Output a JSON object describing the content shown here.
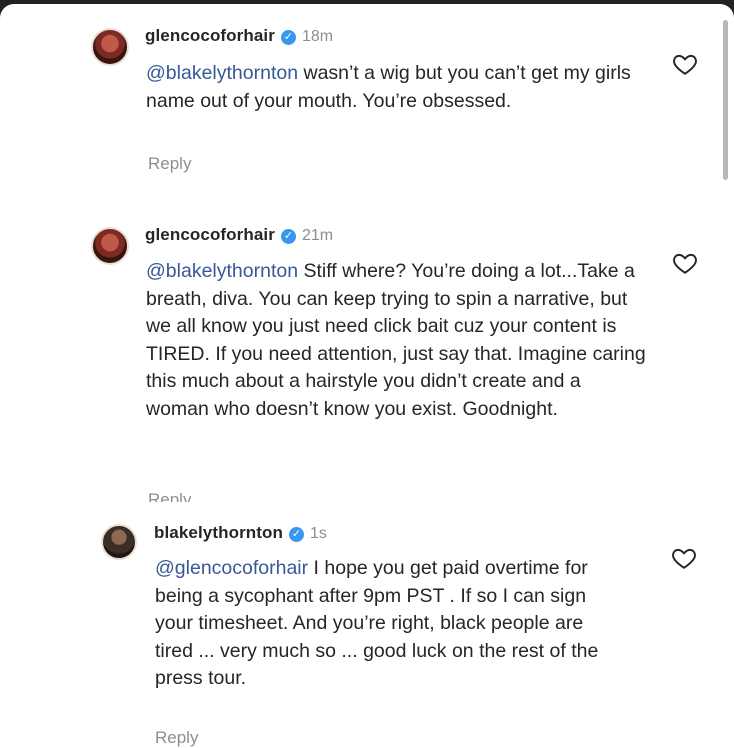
{
  "comments": [
    {
      "username": "glencocoforhair",
      "time": "18m",
      "mention": "@blakelythornton",
      "text": " wasn’t a wig but you can’t get my girls name out of your mouth. You’re obsessed.",
      "reply_label": "Reply",
      "verified_icon": "verified-badge-icon",
      "like_icon": "heart-icon"
    },
    {
      "username": "glencocoforhair",
      "time": "21m",
      "mention": "@blakelythornton",
      "text": " Stiff where? You’re doing a lot...Take a breath, diva. You can keep trying to spin a narrative, but we all know you just need click bait cuz your content is TIRED. If you need attention, just say that. Imagine caring this much about a hairstyle you didn’t create and a woman who doesn’t know you exist. Goodnight.",
      "reply_label": "Reply",
      "verified_icon": "verified-badge-icon",
      "like_icon": "heart-icon"
    },
    {
      "username": "blakelythornton",
      "time": "1s",
      "mention": "@glencocoforhair",
      "text": " I hope you get paid overtime for being a sycophant after 9pm PST . If so I can sign your timesheet.  And you’re right, black people are tired ... very much so ... good luck on the rest of the press tour.",
      "reply_label": "Reply",
      "verified_icon": "verified-badge-icon",
      "like_icon": "heart-icon"
    }
  ],
  "colors": {
    "text": "#262626",
    "secondary": "#8e8e8e",
    "mention": "#385898",
    "verified": "#3897f0"
  }
}
